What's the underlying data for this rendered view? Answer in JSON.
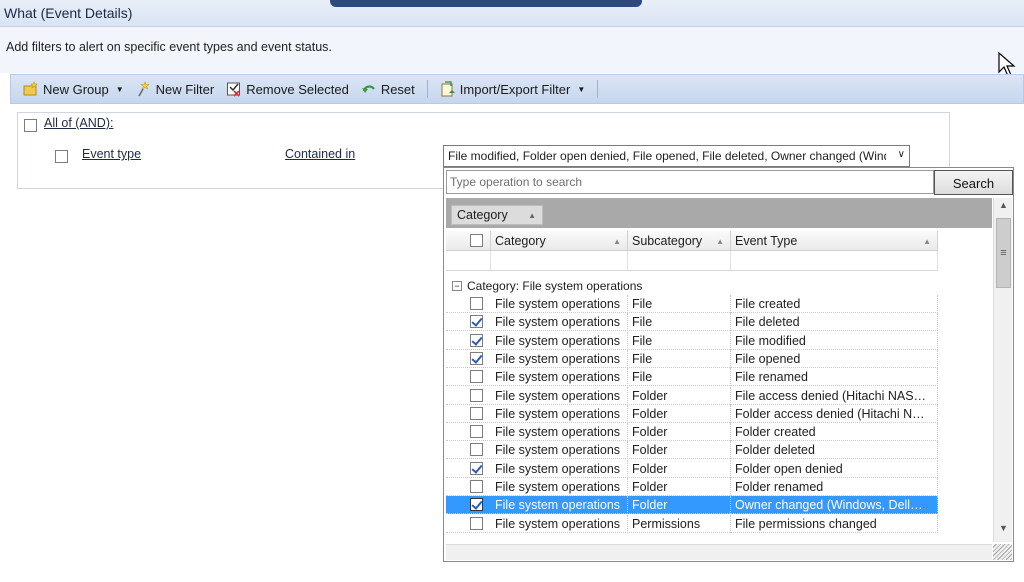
{
  "window": {
    "title": "What (Event Details)"
  },
  "description": "Add filters to alert on specific event types and event status.",
  "toolbar": {
    "new_group": "New Group",
    "new_filter": "New Filter",
    "remove_selected": "Remove Selected",
    "reset": "Reset",
    "import_export": "Import/Export Filter"
  },
  "filter": {
    "group_label": "All of (AND):",
    "field": "Event type",
    "operator": "Contained in",
    "value": "File modified, Folder open denied, File opened, File deleted, Owner changed (Wind"
  },
  "popup": {
    "search_placeholder": "Type operation to search",
    "search_button": "Search",
    "group_by_chip": "Category",
    "columns": [
      "Category",
      "Subcategory",
      "Event Type"
    ],
    "group_header": "Category:  File system operations",
    "rows": [
      {
        "category": "File system operations",
        "subcategory": "File",
        "event_type": "File created",
        "checked": false,
        "selected": false
      },
      {
        "category": "File system operations",
        "subcategory": "File",
        "event_type": "File deleted",
        "checked": true,
        "selected": false
      },
      {
        "category": "File system operations",
        "subcategory": "File",
        "event_type": "File modified",
        "checked": true,
        "selected": false
      },
      {
        "category": "File system operations",
        "subcategory": "File",
        "event_type": "File opened",
        "checked": true,
        "selected": false
      },
      {
        "category": "File system operations",
        "subcategory": "File",
        "event_type": "File renamed",
        "checked": false,
        "selected": false
      },
      {
        "category": "File system operations",
        "subcategory": "Folder",
        "event_type": "File access denied (Hitachi NAS…",
        "checked": false,
        "selected": false
      },
      {
        "category": "File system operations",
        "subcategory": "Folder",
        "event_type": "Folder access denied (Hitachi N…",
        "checked": false,
        "selected": false
      },
      {
        "category": "File system operations",
        "subcategory": "Folder",
        "event_type": "Folder created",
        "checked": false,
        "selected": false
      },
      {
        "category": "File system operations",
        "subcategory": "Folder",
        "event_type": "Folder deleted",
        "checked": false,
        "selected": false
      },
      {
        "category": "File system operations",
        "subcategory": "Folder",
        "event_type": "Folder open denied",
        "checked": true,
        "selected": false
      },
      {
        "category": "File system operations",
        "subcategory": "Folder",
        "event_type": "Folder renamed",
        "checked": false,
        "selected": false
      },
      {
        "category": "File system operations",
        "subcategory": "Folder",
        "event_type": "Owner changed (Windows, Dell…",
        "checked": true,
        "selected": true
      },
      {
        "category": "File system operations",
        "subcategory": "Permissions",
        "event_type": "File permissions changed",
        "checked": false,
        "selected": false
      }
    ]
  },
  "colors": {
    "selection": "#3399ff",
    "toolbar": "#c6d6ee",
    "group_bar": "#a9a9a9"
  }
}
